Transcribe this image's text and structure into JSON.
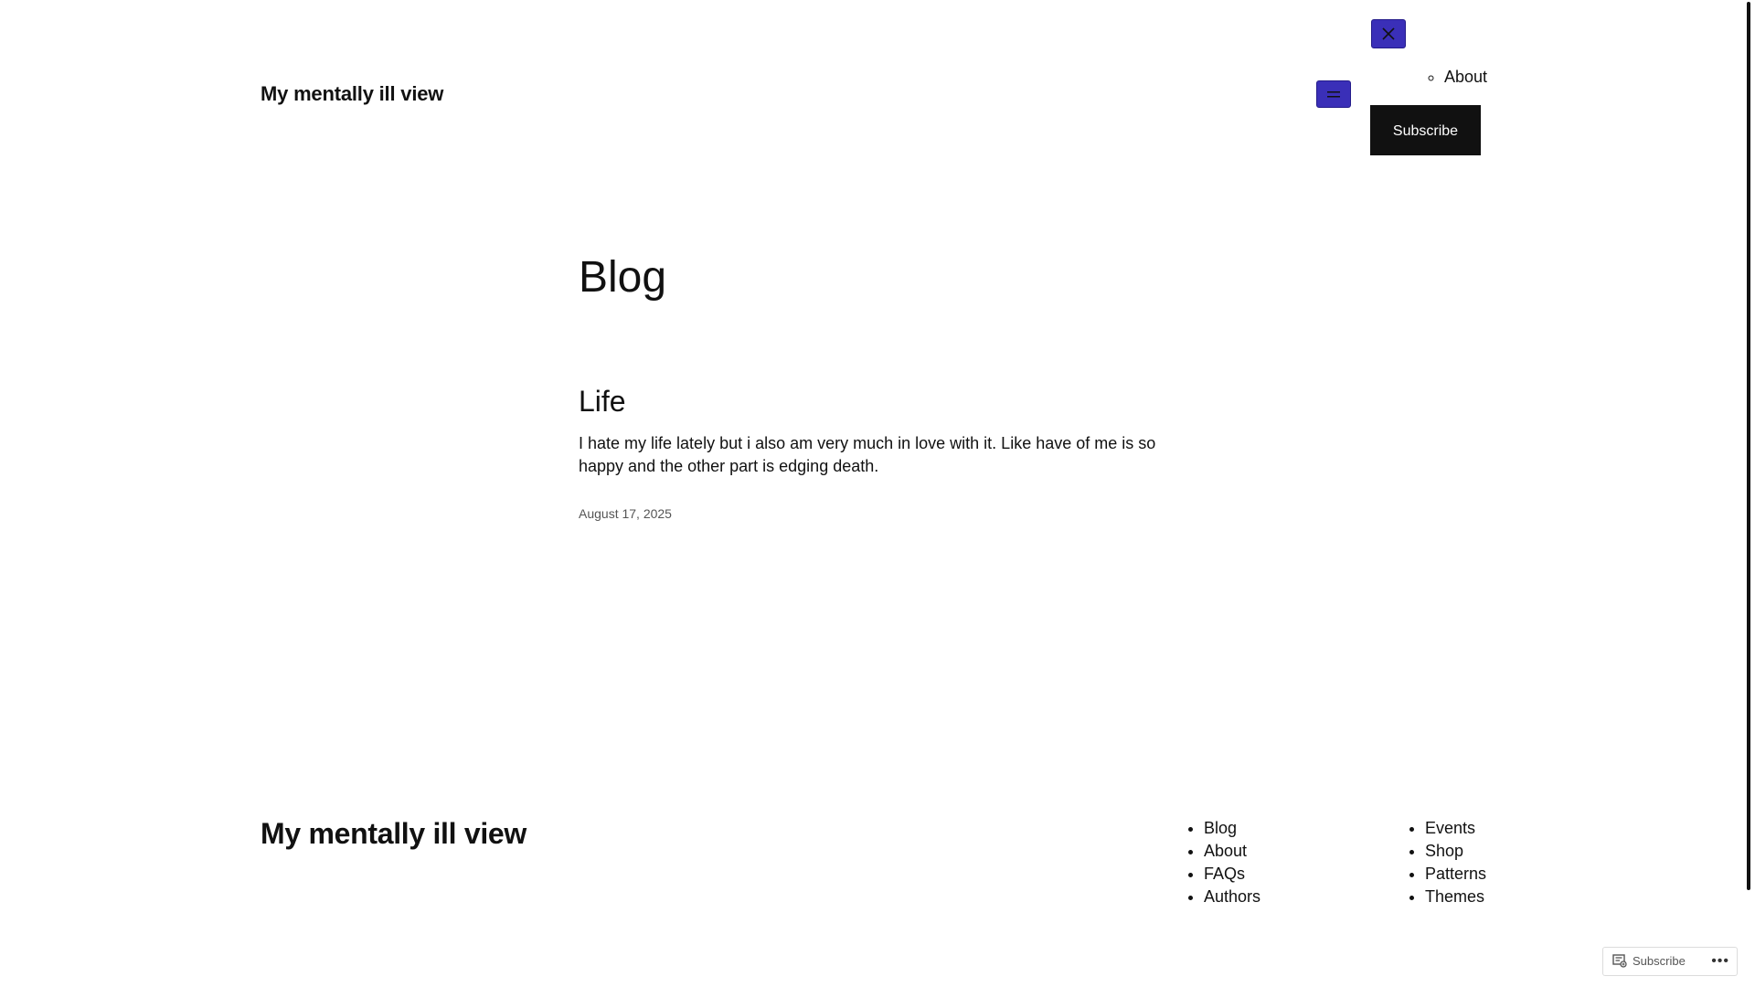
{
  "header": {
    "site_title": "My mentally ill view",
    "menu_open_icon": "hamburger-icon",
    "menu_close_icon": "close-icon",
    "accent_color": "#3a2fb8"
  },
  "overlay_menu": {
    "items": [
      {
        "label": "About"
      }
    ],
    "subscribe_label": "Subscribe"
  },
  "main": {
    "page_title": "Blog",
    "posts": [
      {
        "title": "Life",
        "excerpt": "I hate my life lately but i also am very much in love with it. Like have of me is so happy and the other part is edging death.",
        "date": "August 17, 2025"
      }
    ]
  },
  "footer": {
    "site_title": "My mentally ill view",
    "nav_col_1": [
      {
        "label": "Blog"
      },
      {
        "label": "About"
      },
      {
        "label": "FAQs"
      },
      {
        "label": "Authors"
      }
    ],
    "nav_col_2": [
      {
        "label": "Events"
      },
      {
        "label": "Shop"
      },
      {
        "label": "Patterns"
      },
      {
        "label": "Themes"
      }
    ]
  },
  "wp_action_bar": {
    "subscribe_label": "Subscribe",
    "more_label": "•••",
    "subscribe_icon": "reader-icon"
  }
}
